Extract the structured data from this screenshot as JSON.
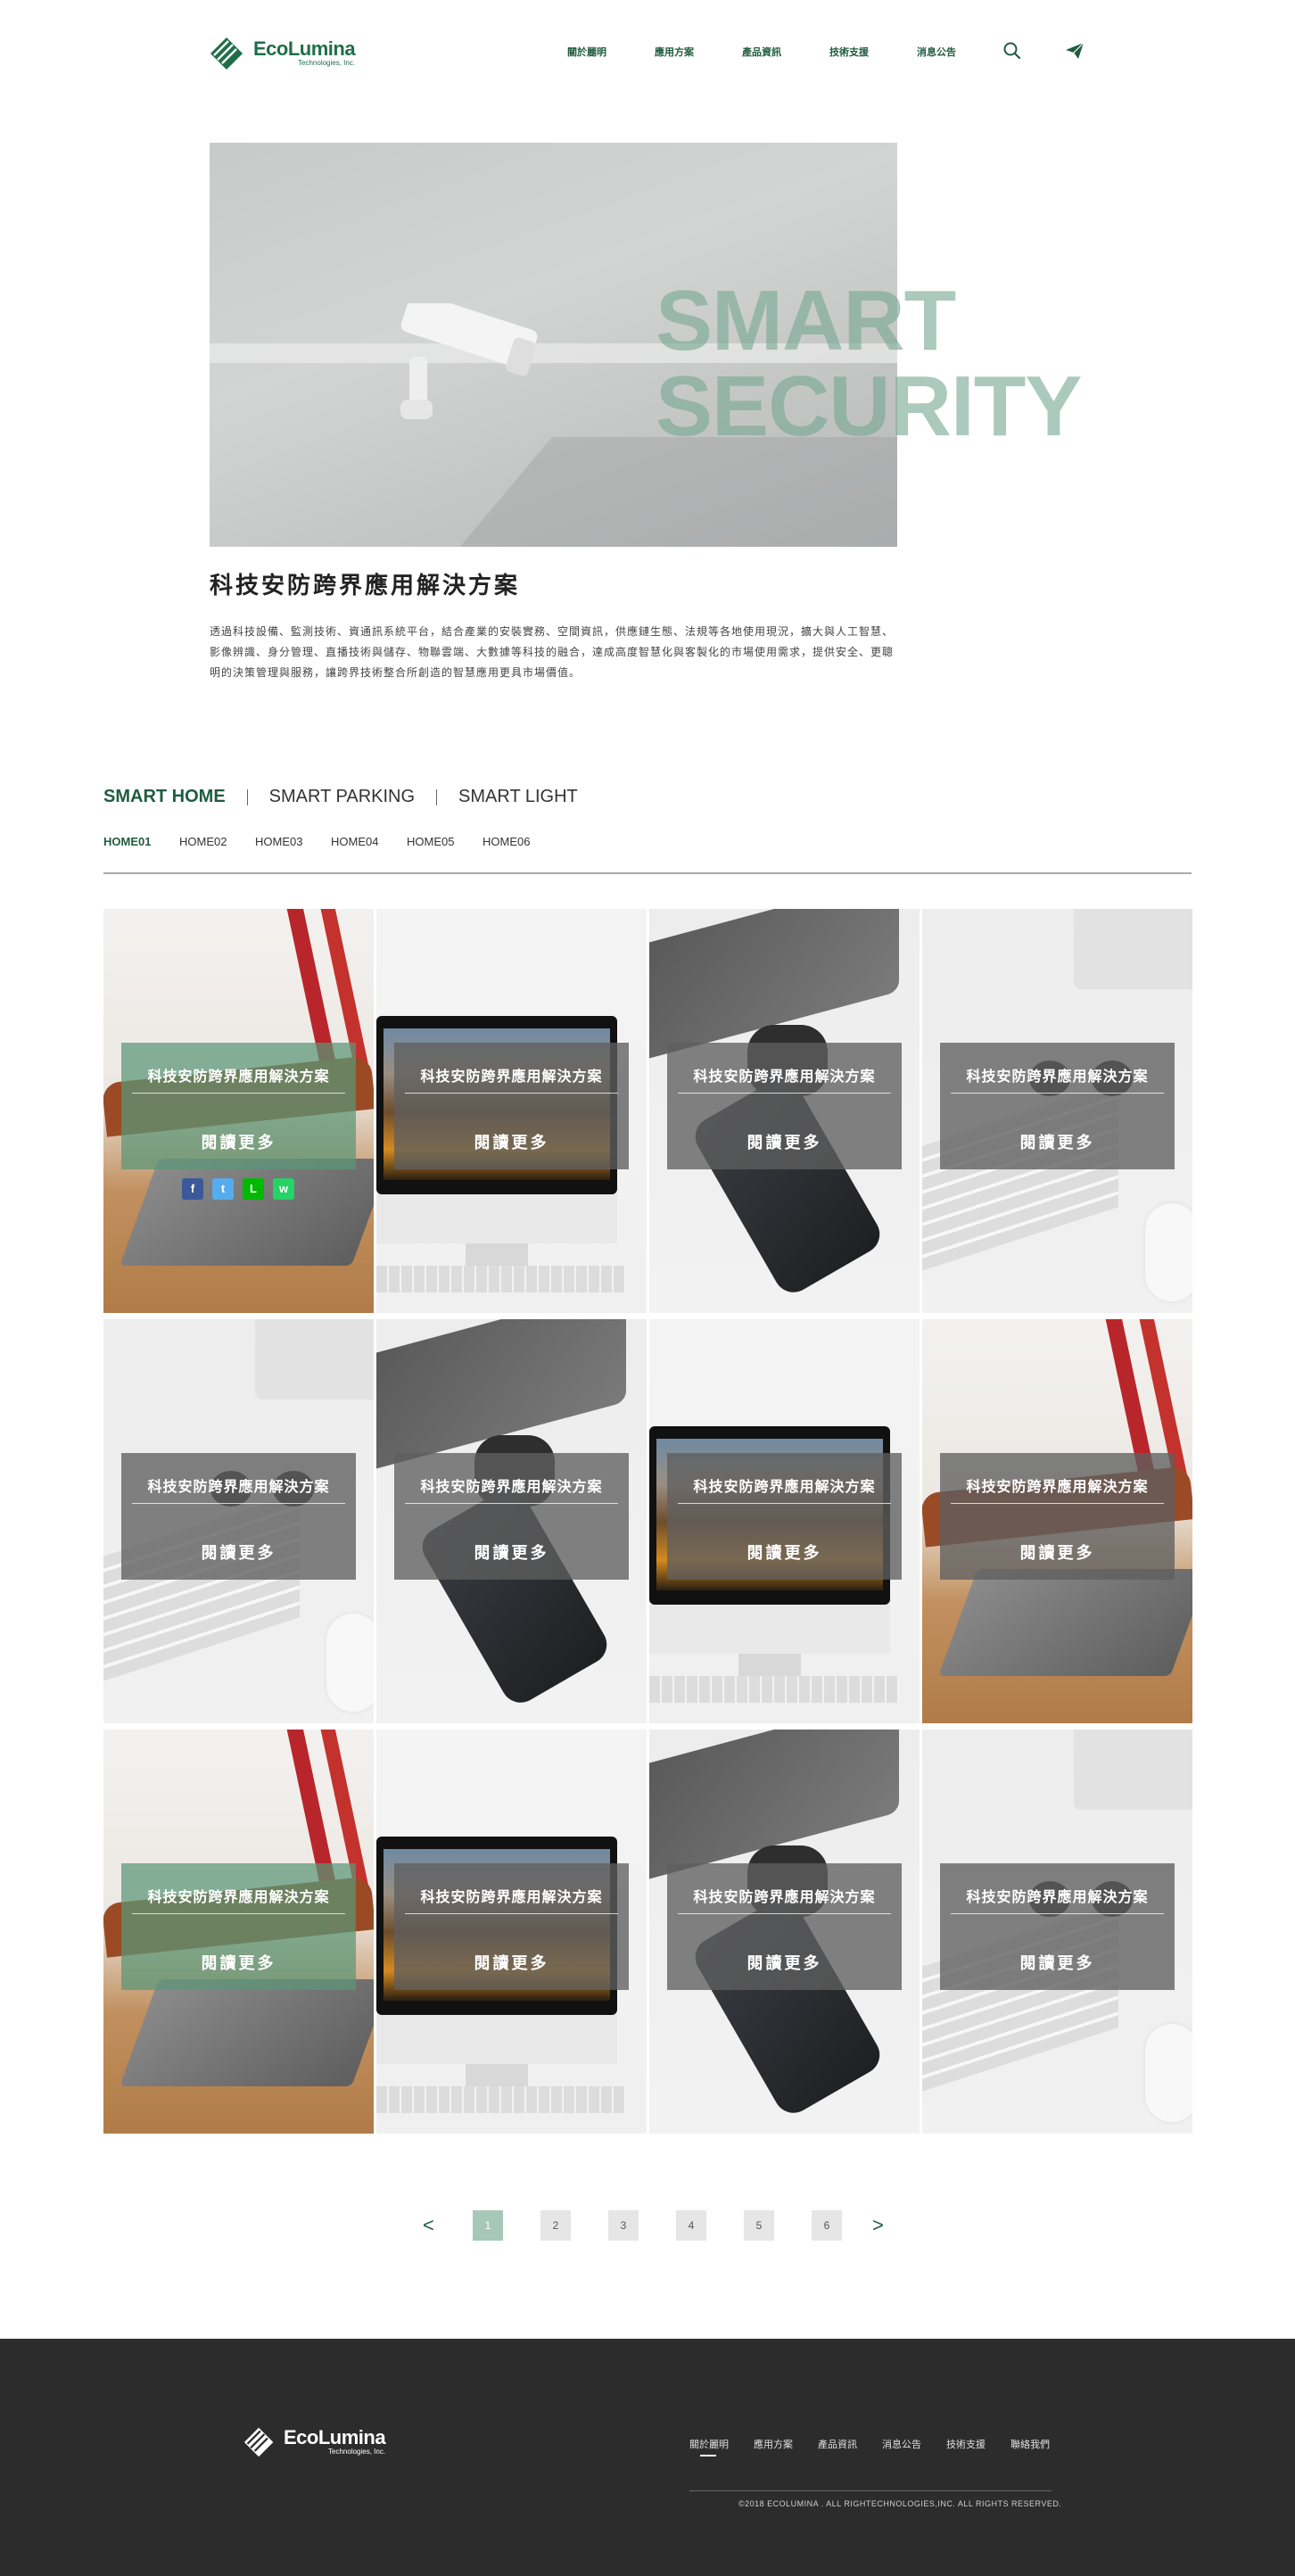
{
  "brand": {
    "name": "EcoLumina",
    "sub": "Technologies, Inc.",
    "color": "#1f6e4a"
  },
  "nav": {
    "items": [
      "關於麗明",
      "應用方案",
      "產品資訊",
      "技術支援",
      "消息公告"
    ]
  },
  "hero": {
    "title_line1": "SMART",
    "title_line2": "SECURITY",
    "heading": "科技安防跨界應用解決方案",
    "intro": "透過科技設備、監測技術、資通訊系統平台，結合產業的安裝實務、空間資訊，供應鏈生態、法規等各地使用現況，擴大與人工智慧、影像辨識、身分管理、直播技術與儲存、物聯雲端、大數據等科技的融合，達成高度智慧化與客製化的市場使用需求，提供安全、更聰明的決策管理與服務，讓跨界技術整合所創造的智慧應用更具市場價值。"
  },
  "categories": [
    "SMART HOME",
    "SMART PARKING",
    "SMART LIGHT"
  ],
  "subcategories": [
    "HOME01",
    "HOME02",
    "HOME03",
    "HOME04",
    "HOME05",
    "HOME06"
  ],
  "cards": [
    {
      "photo": "desk",
      "title": "科技安防跨界應用解決方案",
      "more": "閱讀更多",
      "green": true,
      "share": true
    },
    {
      "photo": "imac",
      "title": "科技安防跨界應用解決方案",
      "more": "閱讀更多"
    },
    {
      "photo": "phone",
      "title": "科技安防跨界應用解決方案",
      "more": "閱讀更多"
    },
    {
      "photo": "kb",
      "title": "科技安防跨界應用解決方案",
      "more": "閱讀更多"
    },
    {
      "photo": "kb",
      "title": "科技安防跨界應用解決方案",
      "more": "閱讀更多"
    },
    {
      "photo": "phone",
      "title": "科技安防跨界應用解決方案",
      "more": "閱讀更多"
    },
    {
      "photo": "imac",
      "title": "科技安防跨界應用解決方案",
      "more": "閱讀更多"
    },
    {
      "photo": "desk",
      "title": "科技安防跨界應用解決方案",
      "more": "閱讀更多"
    },
    {
      "photo": "desk",
      "title": "科技安防跨界應用解決方案",
      "more": "閱讀更多",
      "green": true
    },
    {
      "photo": "imac",
      "title": "科技安防跨界應用解決方案",
      "more": "閱讀更多"
    },
    {
      "photo": "phone",
      "title": "科技安防跨界應用解決方案",
      "more": "閱讀更多"
    },
    {
      "photo": "kb",
      "title": "科技安防跨界應用解決方案",
      "more": "閱讀更多"
    }
  ],
  "share_icons": [
    {
      "icon": "facebook-icon",
      "glyph": "f",
      "color": "#3b5998"
    },
    {
      "icon": "twitter-icon",
      "glyph": "t",
      "color": "#55acee"
    },
    {
      "icon": "line-icon",
      "glyph": "L",
      "color": "#00b900"
    },
    {
      "icon": "whatsapp-icon",
      "glyph": "w",
      "color": "#25d366"
    }
  ],
  "pagination": {
    "prev": "<",
    "next": ">",
    "pages": [
      "1",
      "2",
      "3",
      "4",
      "5",
      "6"
    ],
    "current": "1"
  },
  "footer": {
    "nav": [
      "關於麗明",
      "應用方案",
      "產品資訊",
      "消息公告",
      "技術支援",
      "聯絡我們"
    ],
    "copyright": "©2018 ECOLUMINA . ALL RIGHTECHNOLOGIES,INC. ALL RIGHTS RESERVED."
  }
}
